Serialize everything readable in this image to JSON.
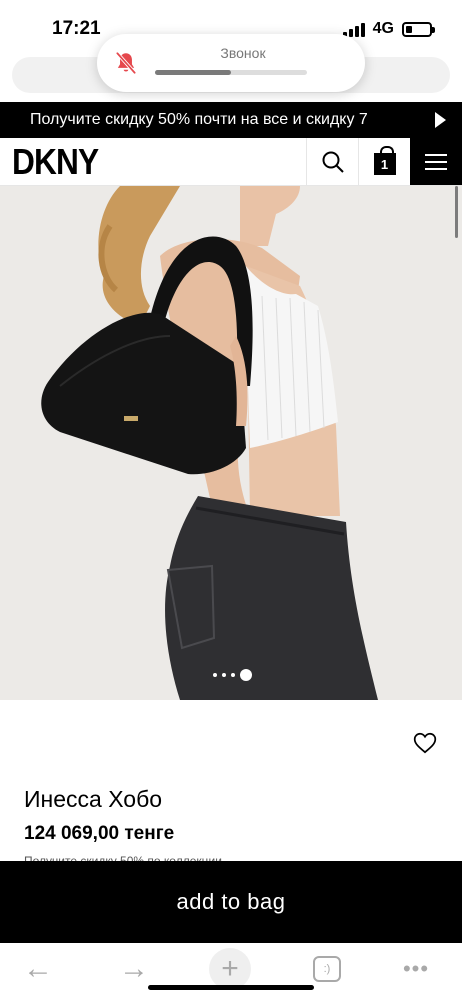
{
  "status_bar": {
    "time": "17:21",
    "network": "4G",
    "battery_level": 0.25
  },
  "ringer": {
    "label": "Звонок",
    "icon": "bell-slash-icon",
    "volume_level": 0.5,
    "icon_color": "#e5484d"
  },
  "promo": {
    "text": "Получите скидку 50% почти на все и скидку 7"
  },
  "header": {
    "logo": "DKNY",
    "bag_count": "1"
  },
  "product": {
    "carousel_total": 4,
    "carousel_active": 4,
    "name": "Инесса Хобо",
    "price": "124 069,00 тенге",
    "promo_note": "Получите скидку 50% по коллекции"
  },
  "actions": {
    "add_to_bag": "add to bag"
  },
  "browser": {
    "tabs_label": ":)"
  }
}
